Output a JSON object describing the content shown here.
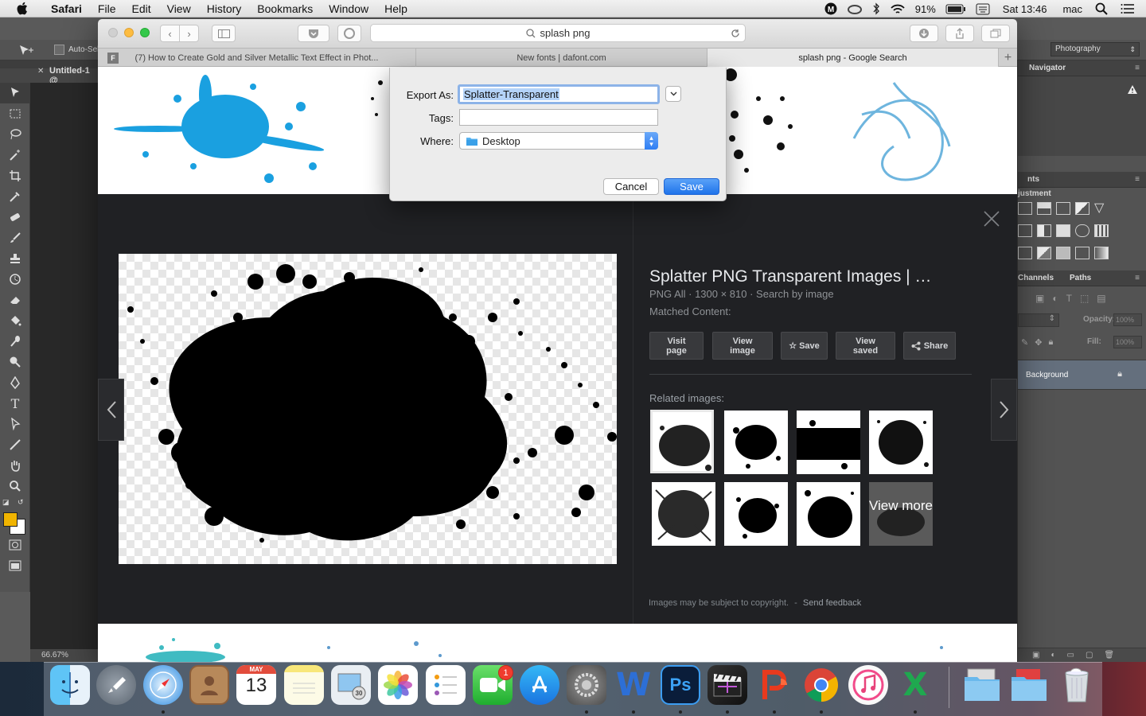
{
  "menubar": {
    "app": "Safari",
    "items": [
      "File",
      "Edit",
      "View",
      "History",
      "Bookmarks",
      "Window",
      "Help"
    ],
    "battery": "91%",
    "clock": "Sat 13:46",
    "user": "mac"
  },
  "photoshop": {
    "auto_select": "Auto-Sel",
    "doc_tab": "Untitled-1 @",
    "workspace": "Photography",
    "navigator": "Navigator",
    "adjustments_tab": "nts",
    "adjustments_label": "justment",
    "channels": "Channels",
    "paths": "Paths",
    "opacity_label": "Opacity:",
    "opacity_value": "100%",
    "fill_label": "Fill:",
    "fill_value": "100%",
    "layer_name": "Background",
    "zoom": "66.67%",
    "foreground_color": "#f0b400"
  },
  "safari": {
    "address": "splash png",
    "tabs": [
      "(7) How to Create Gold and Silver Metallic Text Effect in Phot...",
      "New fonts | dafont.com",
      "splash png - Google Search"
    ],
    "active_tab": 2
  },
  "result": {
    "title": "Splatter PNG Transparent Images | …",
    "meta": "PNG All · 1300 × 810 · Search by image",
    "matched": "Matched Content:",
    "buttons": {
      "visit_page": "Visit page",
      "view_image": "View image",
      "save": "Save",
      "view_saved": "View saved",
      "share": "Share"
    },
    "related_label": "Related images:",
    "view_more": "View more",
    "footer_copy": "Images may be subject to copyright.",
    "footer_sep": "-",
    "footer_feedback": "Send feedback"
  },
  "dialog": {
    "export_label": "Export As:",
    "export_value": "Splatter-Transparent",
    "tags_label": "Tags:",
    "tags_value": "",
    "where_label": "Where:",
    "where_value": "Desktop",
    "cancel": "Cancel",
    "save": "Save"
  },
  "dock": {
    "calendar_month": "MAY",
    "calendar_day": "13",
    "facetime_badge": "1",
    "photoshop_label": "Ps",
    "word_label": "W",
    "excel_label": "X"
  }
}
